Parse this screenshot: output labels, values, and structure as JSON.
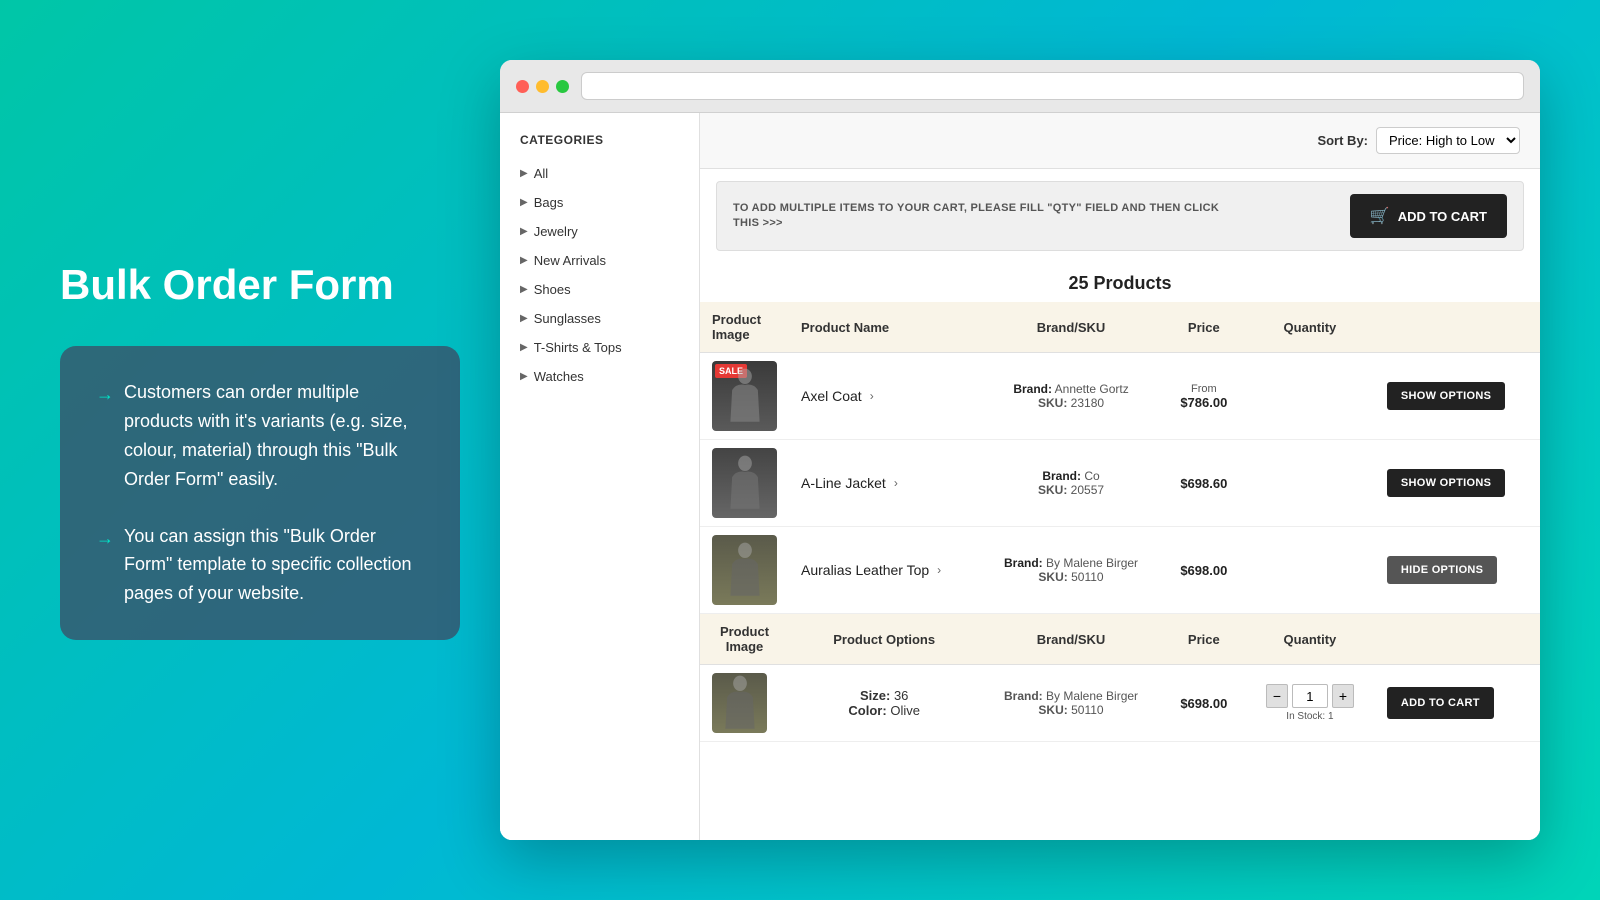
{
  "page": {
    "title": "Bulk Order Form",
    "background_gradient": "linear-gradient(135deg, #00c6a7, #00b8d4)"
  },
  "left_panel": {
    "heading": "Bulk Order Form",
    "bullets": [
      {
        "id": "bullet1",
        "text": "Customers can order multiple products with it's variants (e.g. size, colour, material) through this \"Bulk Order Form\" easily."
      },
      {
        "id": "bullet2",
        "text": "You can assign this \"Bulk Order Form\" template to specific collection pages of your website."
      }
    ]
  },
  "browser": {
    "address_bar_placeholder": ""
  },
  "sidebar": {
    "title": "CATEGORIES",
    "items": [
      {
        "id": "all",
        "label": "All"
      },
      {
        "id": "bags",
        "label": "Bags"
      },
      {
        "id": "jewelry",
        "label": "Jewelry"
      },
      {
        "id": "new-arrivals",
        "label": "New Arrivals"
      },
      {
        "id": "shoes",
        "label": "Shoes"
      },
      {
        "id": "sunglasses",
        "label": "Sunglasses"
      },
      {
        "id": "tshirts",
        "label": "T-Shirts & Tops"
      },
      {
        "id": "watches",
        "label": "Watches"
      }
    ]
  },
  "toolbar": {
    "sort_by_label": "Sort By:",
    "sort_value": "Price: High to Low"
  },
  "cart_banner": {
    "text": "TO ADD MULTIPLE ITEMS TO YOUR CART, PLEASE FILL \"QTY\" FIELD AND THEN CLICK THIS >>>",
    "button_label": "ADD TO CART"
  },
  "products": {
    "count_label": "25 Products",
    "table_headers": {
      "image": "Product Image",
      "name": "Product Name",
      "brand_sku": "Brand/SKU",
      "price": "Price",
      "quantity": "Quantity"
    },
    "items": [
      {
        "id": "axel-coat",
        "name": "Axel Coat",
        "sale": true,
        "img_style": "coat",
        "brand": "Annette Gortz",
        "sku": "23180",
        "price": "$786.00",
        "price_prefix": "From",
        "action": "SHOW OPTIONS",
        "expanded": false
      },
      {
        "id": "aline-jacket",
        "name": "A-Line Jacket",
        "sale": false,
        "img_style": "jacket",
        "brand": "Co",
        "sku": "20557",
        "price": "$698.60",
        "price_prefix": "",
        "action": "SHOW OPTIONS",
        "expanded": false
      },
      {
        "id": "auralias-leather-top",
        "name": "Auralias Leather Top",
        "sale": false,
        "img_style": "top",
        "brand": "By Malene Birger",
        "sku": "50110",
        "price": "$698.00",
        "price_prefix": "",
        "action": "HIDE OPTIONS",
        "expanded": true
      }
    ],
    "options_headers": {
      "image": "Product Image",
      "options": "Product Options",
      "brand_sku": "Brand/SKU",
      "price": "Price",
      "quantity": "Quantity"
    },
    "expanded_item": {
      "product_id": "auralias-leather-top",
      "img_style": "top",
      "size_label": "Size:",
      "size_value": "36",
      "color_label": "Color:",
      "color_value": "Olive",
      "brand": "By Malene Birger",
      "sku": "50110",
      "price": "$698.00",
      "qty": "1",
      "in_stock": "In Stock: 1",
      "button_label": "ADD TO CART"
    }
  }
}
